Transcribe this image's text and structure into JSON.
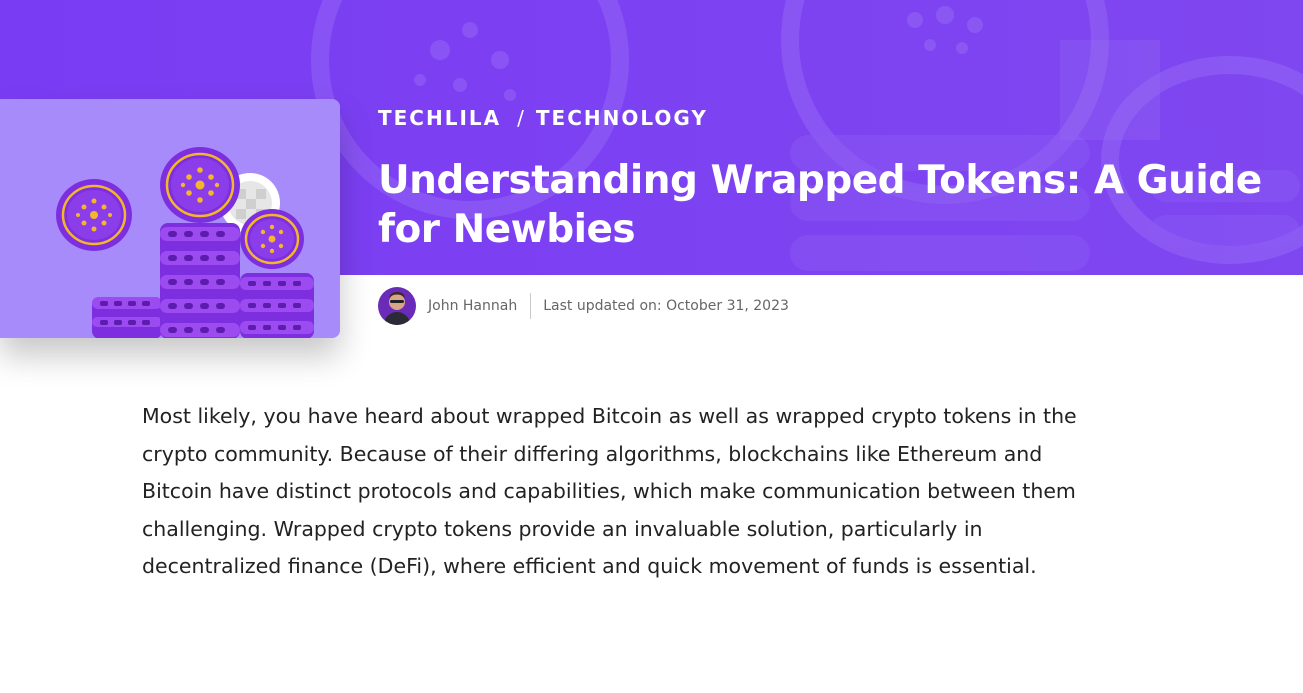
{
  "colors": {
    "hero_bg": "#7b3ff2",
    "thumb_bg": "#a88bfb",
    "coin_purple": "#8a3de8",
    "coin_gold": "#f4b62a"
  },
  "breadcrumb": {
    "site": "TECHLILA",
    "separator": "/",
    "category": "TECHNOLOGY"
  },
  "article": {
    "title": "Understanding Wrapped Tokens: A Guide for Newbies",
    "author": "John Hannah",
    "updated": "Last updated on: October 31, 2023",
    "body": "Most likely, you have heard about wrapped Bitcoin as well as wrapped crypto tokens in the crypto community. Because of their differing algorithms, blockchains like Ethereum and Bitcoin have distinct protocols and capabilities, which make communication between them challenging.  Wrapped crypto tokens provide an invaluable solution, particularly in decentralized finance (DeFi), where efficient and quick movement of funds is essential."
  },
  "images": {
    "featured": "cardano-coins-illustration",
    "author_avatar": "author-avatar-photo"
  }
}
